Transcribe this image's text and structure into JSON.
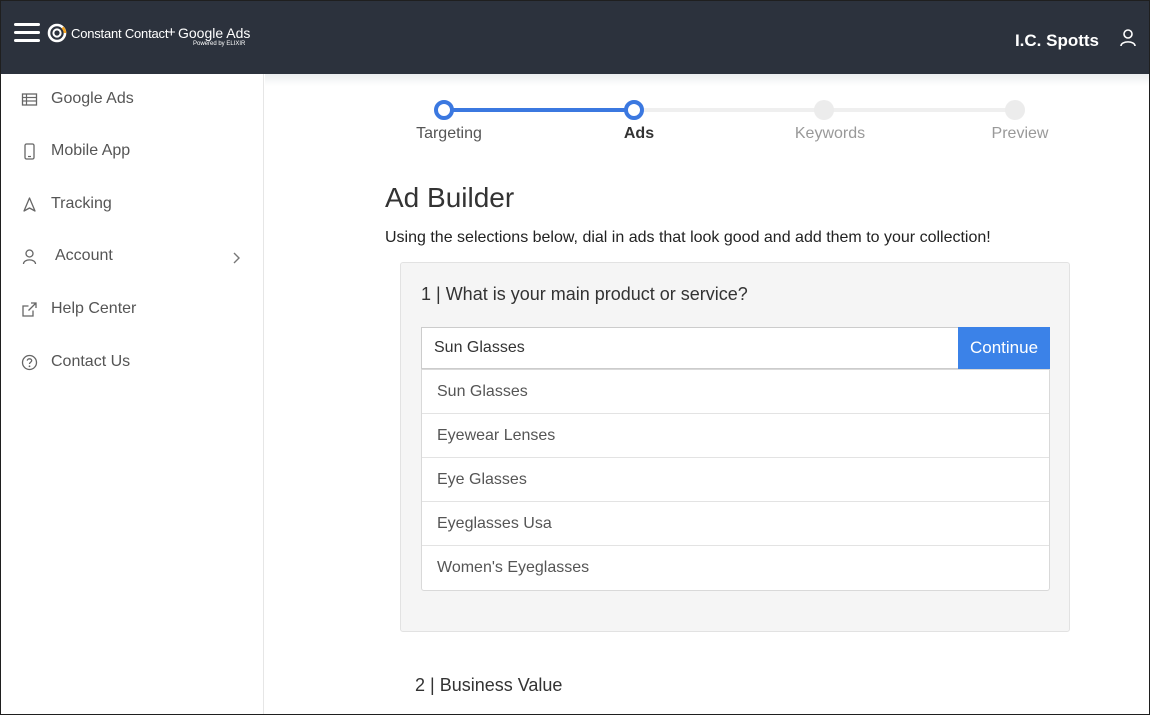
{
  "header": {
    "brand_primary": "Constant Contact",
    "brand_plus": "+",
    "brand_secondary": "Google Ads",
    "brand_powered": "Powered by ELIXIR",
    "user_name": "I.C. Spotts",
    "background_color": "#2c323d"
  },
  "sidebar": {
    "items": [
      {
        "label": "Google Ads",
        "icon": "table-icon"
      },
      {
        "label": "Mobile App",
        "icon": "mobile-icon"
      },
      {
        "label": "Tracking",
        "icon": "navigation-icon"
      },
      {
        "label": "Account",
        "icon": "user-icon",
        "has_submenu": true
      },
      {
        "label": "Help Center",
        "icon": "external-link-icon"
      },
      {
        "label": "Contact Us",
        "icon": "question-circle-icon"
      }
    ]
  },
  "stepper": {
    "steps": [
      {
        "label": "Targeting",
        "state": "done"
      },
      {
        "label": "Ads",
        "state": "current"
      },
      {
        "label": "Keywords",
        "state": "todo"
      },
      {
        "label": "Preview",
        "state": "todo"
      }
    ],
    "accent_color": "#3b78e0"
  },
  "main": {
    "title": "Ad Builder",
    "description": "Using the selections below, dial in ads that look good and add them to your collection!",
    "question1": "1 | What is your main product or service?",
    "search_value": "Sun Glasses",
    "continue_label": "Continue",
    "suggestions": [
      "Sun Glasses",
      "Eyewear Lenses",
      "Eye Glasses",
      "Eyeglasses Usa",
      "Women's Eyeglasses"
    ],
    "question2": "2 | Business Value"
  }
}
